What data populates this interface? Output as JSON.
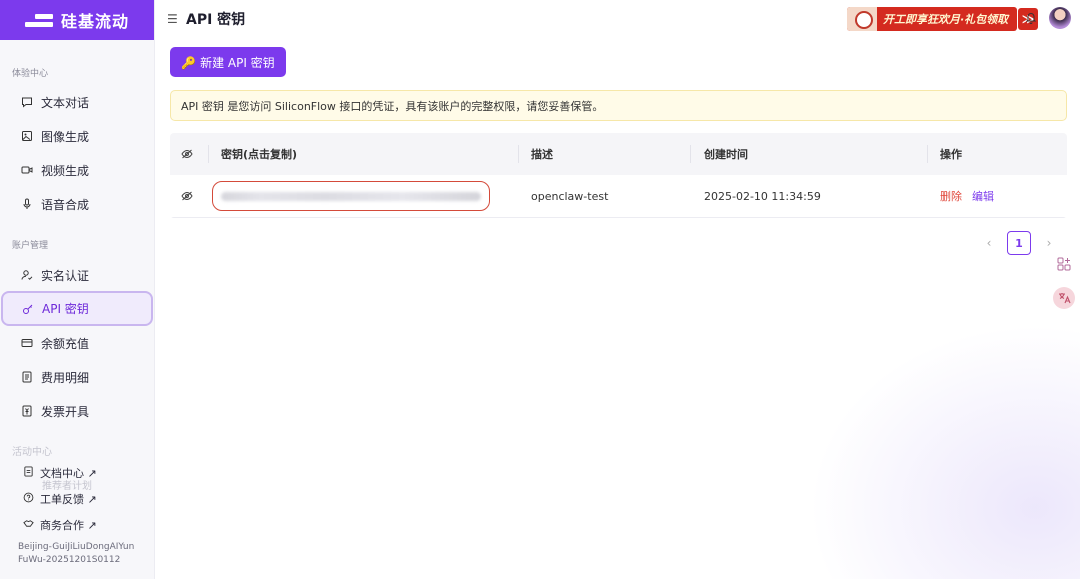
{
  "app": {
    "logo_text": "硅基流动",
    "brand_color": "#7c3aed"
  },
  "sidebar": {
    "section_experience": "体验中心",
    "experience_items": [
      {
        "label": "文本对话",
        "icon": "chat-icon"
      },
      {
        "label": "图像生成",
        "icon": "image-icon"
      },
      {
        "label": "视频生成",
        "icon": "video-icon"
      },
      {
        "label": "语音合成",
        "icon": "mic-icon"
      }
    ],
    "section_account": "账户管理",
    "account_items": [
      {
        "label": "实名认证",
        "icon": "user-check-icon"
      },
      {
        "label": "API 密钥",
        "icon": "key-icon",
        "active": true
      },
      {
        "label": "余额充值",
        "icon": "card-icon"
      },
      {
        "label": "费用明细",
        "icon": "list-icon"
      },
      {
        "label": "发票开具",
        "icon": "invoice-icon"
      }
    ],
    "faded_section": "活动中心",
    "faded_item": "推荐者计划",
    "footer_links": [
      {
        "label": "文档中心 ↗",
        "icon": "doc-icon"
      },
      {
        "label": "工单反馈 ↗",
        "icon": "help-icon"
      },
      {
        "label": "商务合作 ↗",
        "icon": "handshake-icon"
      }
    ],
    "version_line1": "Beijing-GuiJiLiuDongAIYun",
    "version_line2": "FuWu-20251201S0112"
  },
  "header": {
    "menu_icon": "menu-icon",
    "title": "API 密钥",
    "promo_text": "开工即享狂欢月·礼包领取",
    "promo_arrow": "≫"
  },
  "main": {
    "new_button_label": "🔑 新建 API 密钥",
    "notice": "API 密钥 是您访问 SiliconFlow 接口的凭证，具有该账户的完整权限，请您妥善保管。",
    "table": {
      "headers": {
        "key": "密钥(点击复制)",
        "description": "描述",
        "created": "创建时间",
        "actions": "操作"
      },
      "rows": [
        {
          "key": "sk-•••••••••••••••••••••••••••••••••••••••",
          "description": "openclaw-test",
          "created": "2025-02-10 11:34:59",
          "delete": "删除",
          "edit": "编辑"
        }
      ]
    },
    "pagination": {
      "prev": "‹",
      "current": "1",
      "next": "›"
    }
  }
}
